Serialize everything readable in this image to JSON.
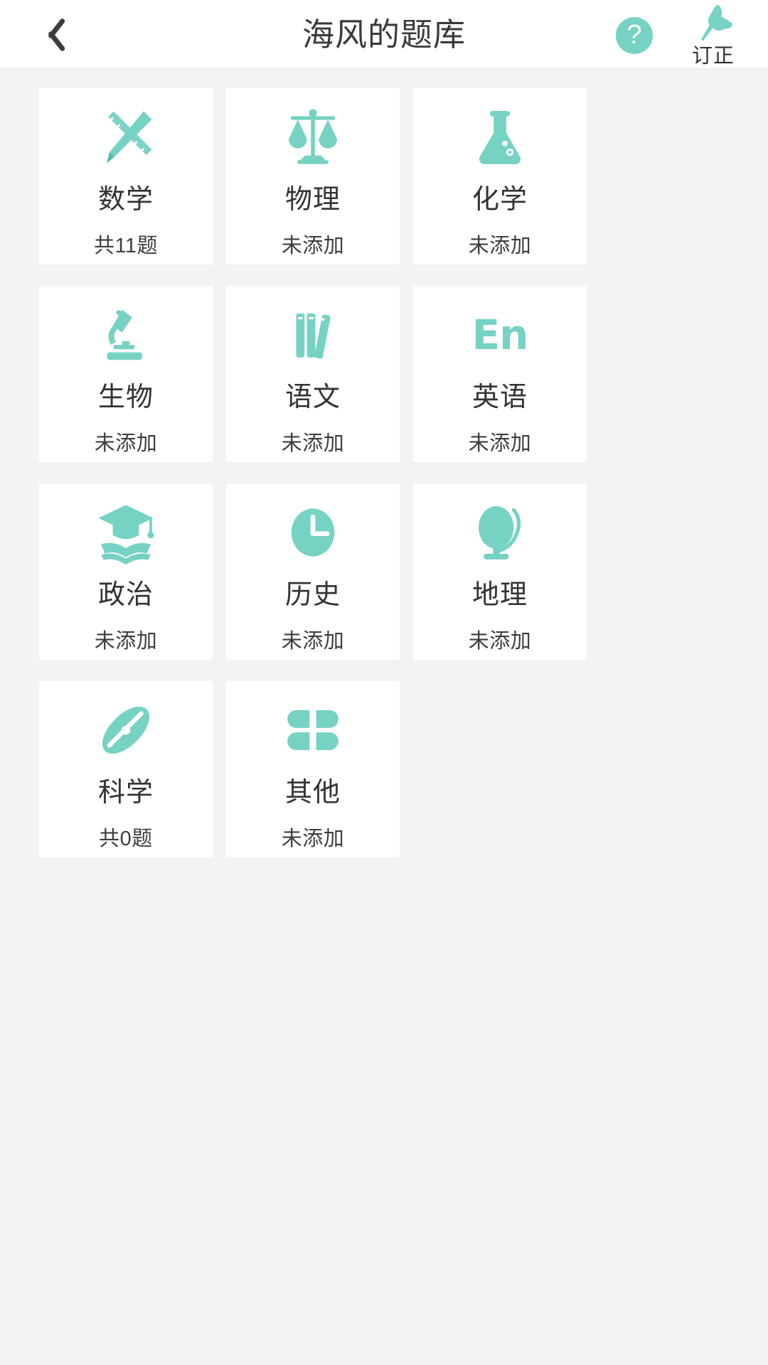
{
  "header": {
    "title": "海风的题库",
    "back_icon": "chevron-left-icon",
    "help_icon": "question-mark-icon",
    "help_label": "?",
    "pin_icon": "pushpin-icon",
    "correct_label": "订正"
  },
  "theme": {
    "accent": "#76d2c3",
    "background": "#f2f3f3",
    "card_background": "#ffffff",
    "title_text": "#333333",
    "subtitle_text": "#3d3d3d"
  },
  "subjects": [
    {
      "name": "数学",
      "status": "共11题",
      "icon": "pencil-ruler-icon"
    },
    {
      "name": "物理",
      "status": "未添加",
      "icon": "balance-scale-icon"
    },
    {
      "name": "化学",
      "status": "未添加",
      "icon": "flask-icon"
    },
    {
      "name": "生物",
      "status": "未添加",
      "icon": "microscope-icon"
    },
    {
      "name": "语文",
      "status": "未添加",
      "icon": "books-icon"
    },
    {
      "name": "英语",
      "status": "未添加",
      "icon": "en-text-icon",
      "icon_text": "En"
    },
    {
      "name": "政治",
      "status": "未添加",
      "icon": "graduation-cap-icon"
    },
    {
      "name": "历史",
      "status": "未添加",
      "icon": "clock-icon"
    },
    {
      "name": "地理",
      "status": "未添加",
      "icon": "globe-icon"
    },
    {
      "name": "科学",
      "status": "共0题",
      "icon": "atom-icon"
    },
    {
      "name": "其他",
      "status": "未添加",
      "icon": "four-petal-icon"
    }
  ]
}
